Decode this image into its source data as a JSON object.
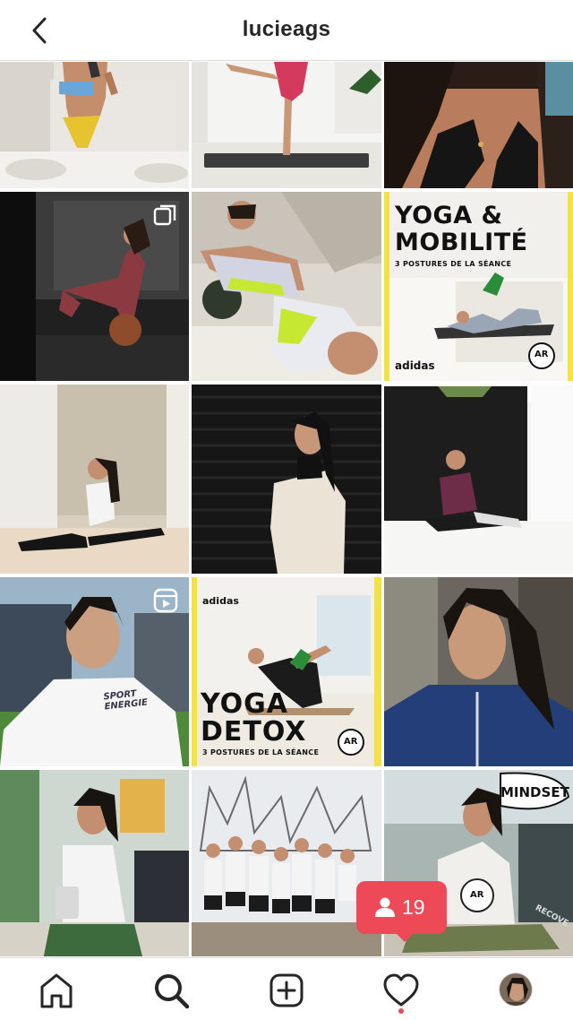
{
  "header": {
    "title": "lucieags",
    "back_icon": "chevron-left-icon"
  },
  "posts": [
    {
      "subject": "mirror selfie in bathroom"
    },
    {
      "subject": "standing yoga pose on mat"
    },
    {
      "subject": "close-up black bikini"
    },
    {
      "subject": "plank on medicine ball in gym",
      "badge": "carousel-icon"
    },
    {
      "subject": "lying pose in sports outfit"
    },
    {
      "subject": "yoga and mobility cover",
      "title": "YOGA &\nMOBILITÉ",
      "subtitle": "3 POSTURES DE LA SÉANCE",
      "brand": "adidas",
      "logo": "AR"
    },
    {
      "subject": "front split by wall"
    },
    {
      "subject": "portrait by black shutter"
    },
    {
      "subject": "seated stretch in studio"
    },
    {
      "subject": "portrait in white t-shirt",
      "badge": "reels-icon",
      "shirt_text": "SPORT\nENERGIE"
    },
    {
      "subject": "yoga detox cover",
      "title": "YOGA\nDETOX",
      "subtitle": "3 POSTURES DE LA SÉANCE",
      "brand": "adidas",
      "logo": "AR"
    },
    {
      "subject": "selfie in blue track jacket"
    },
    {
      "subject": "holding shoes indoors"
    },
    {
      "subject": "group running crew in park"
    },
    {
      "subject": "seated meditation with illustrations",
      "doodle_text": "MINDSET",
      "doodle_text_2": "RECOVE",
      "logo": "AR"
    }
  ],
  "notification": {
    "icon": "user-icon",
    "count": "19",
    "color": "#ed4956"
  },
  "bottom_nav": {
    "items": [
      {
        "name": "home",
        "icon": "home-icon"
      },
      {
        "name": "search",
        "icon": "search-icon",
        "active": true
      },
      {
        "name": "new-post",
        "icon": "add-post-icon"
      },
      {
        "name": "activity",
        "icon": "heart-icon",
        "has_notification_dot": true
      },
      {
        "name": "profile",
        "icon": "profile-avatar"
      }
    ]
  },
  "colors": {
    "accent_red": "#ed4956",
    "text": "#262626",
    "divider": "#dbdbdb",
    "yellow_border": "#f3e04a"
  }
}
